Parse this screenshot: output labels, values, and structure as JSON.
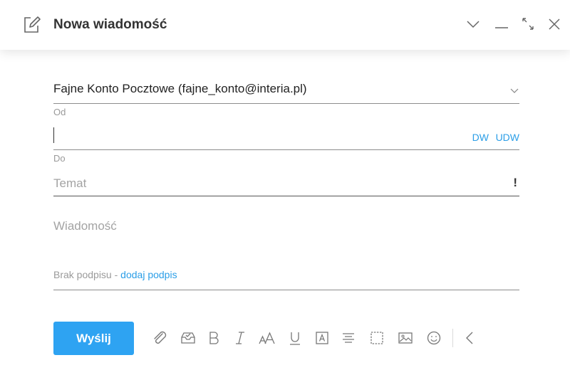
{
  "header": {
    "title": "Nowa wiadomość",
    "icons": [
      "compose-icon",
      "chevron-down-icon",
      "minimize-icon",
      "expand-icon",
      "close-icon"
    ]
  },
  "from": {
    "value": "Fajne Konto Pocztowe (fajne_konto@interia.pl)",
    "label": "Od"
  },
  "to": {
    "value": "",
    "label": "Do",
    "cc_label": "DW",
    "bcc_label": "UDW"
  },
  "subject": {
    "placeholder": "Temat",
    "priority_label": "!"
  },
  "message": {
    "placeholder": "Wiadomość"
  },
  "signature": {
    "text": "Brak podpisu - ",
    "link": "dodaj podpis"
  },
  "toolbar": {
    "send_label": "Wyślij",
    "font_size_label": "AA",
    "tools": [
      "attachment-icon",
      "inbox-icon",
      "bold-icon",
      "italic-icon",
      "font-size-icon",
      "underline-icon",
      "text-color-icon",
      "align-icon",
      "border-icon",
      "image-icon",
      "emoji-icon",
      "collapse-icon"
    ]
  },
  "colors": {
    "accent": "#2ea3f2",
    "link": "#2b9ee7",
    "label": "#9a9a9a"
  }
}
